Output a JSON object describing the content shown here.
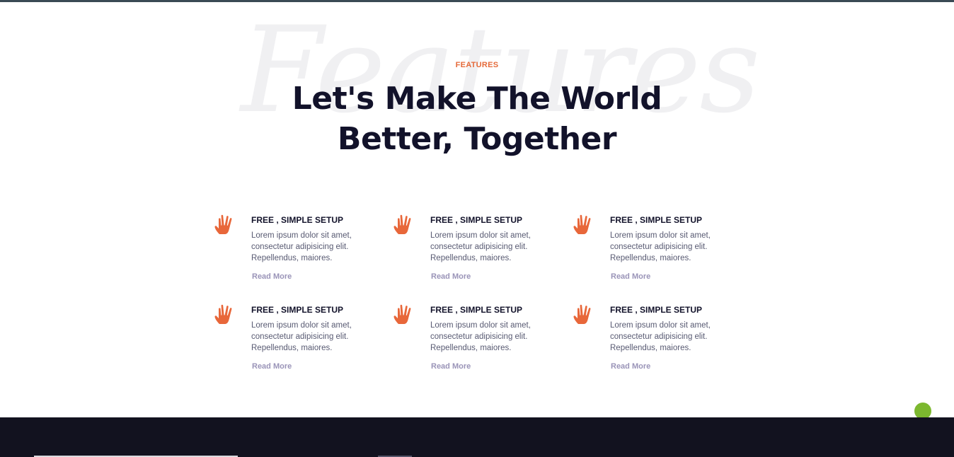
{
  "hero": {
    "watermark": "Features",
    "eyebrow": "FEATURES",
    "headline_line1": "Let's Make The World",
    "headline_line2": "Better, Together"
  },
  "colors": {
    "accent": "#e56a3a",
    "heading": "#12122a",
    "body_text": "#585a72",
    "link": "#9a94b8",
    "fab": "#7cb82f",
    "footer_bg": "#12121f"
  },
  "features": [
    {
      "icon": "hand-icon",
      "title": "FREE , SIMPLE SETUP",
      "desc_line1": "Lorem ipsum dolor sit amet,",
      "desc_line2": "consectetur adipisicing elit.",
      "desc_line3": "Repellendus, maiores.",
      "link": "Read More"
    },
    {
      "icon": "hand-icon",
      "title": "FREE , SIMPLE SETUP",
      "desc_line1": "Lorem ipsum dolor sit amet,",
      "desc_line2": "consectetur adipisicing elit.",
      "desc_line3": "Repellendus, maiores.",
      "link": "Read More"
    },
    {
      "icon": "hand-icon",
      "title": "FREE , SIMPLE SETUP",
      "desc_line1": "Lorem ipsum dolor sit amet,",
      "desc_line2": "consectetur adipisicing elit.",
      "desc_line3": "Repellendus, maiores.",
      "link": "Read More"
    },
    {
      "icon": "hand-icon",
      "title": "FREE , SIMPLE SETUP",
      "desc_line1": "Lorem ipsum dolor sit amet,",
      "desc_line2": "consectetur adipisicing elit.",
      "desc_line3": "Repellendus, maiores.",
      "link": "Read More"
    },
    {
      "icon": "hand-icon",
      "title": "FREE , SIMPLE SETUP",
      "desc_line1": "Lorem ipsum dolor sit amet,",
      "desc_line2": "consectetur adipisicing elit.",
      "desc_line3": "Repellendus, maiores.",
      "link": "Read More"
    },
    {
      "icon": "hand-icon",
      "title": "FREE , SIMPLE SETUP",
      "desc_line1": "Lorem ipsum dolor sit amet,",
      "desc_line2": "consectetur adipisicing elit.",
      "desc_line3": "Repellendus, maiores.",
      "link": "Read More"
    }
  ]
}
